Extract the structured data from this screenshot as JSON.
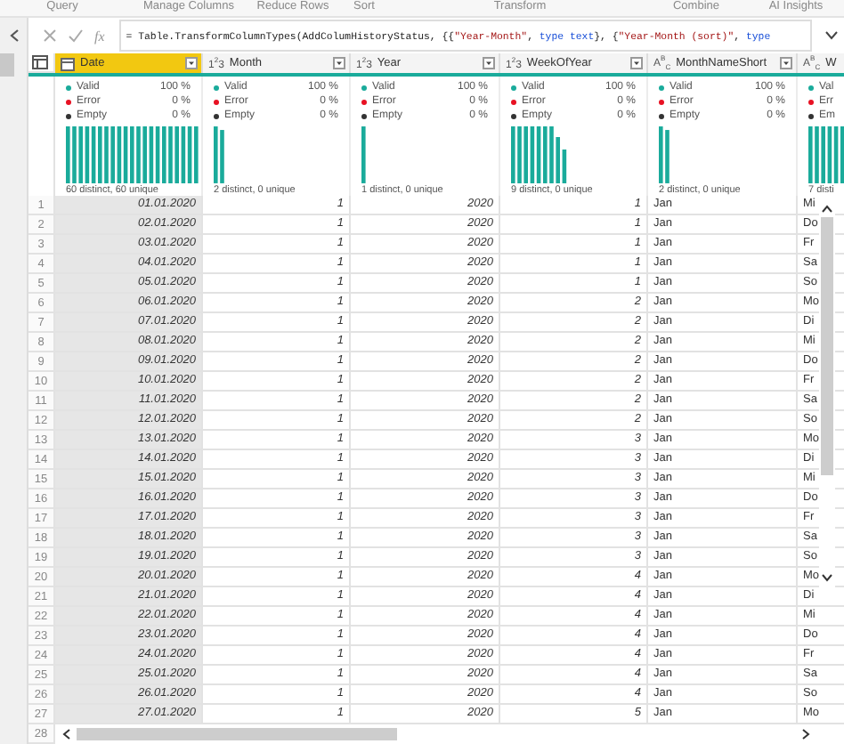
{
  "ribbon_groups": [
    "Query",
    "Manage Columns",
    "Reduce Rows",
    "Sort",
    "Transform",
    "Combine",
    "AI Insights"
  ],
  "formula_bar": {
    "fx": "fx",
    "formula": [
      {
        "kind": "plain",
        "text": "= Table.TransformColumnTypes(AddColumHistoryStatus, {{"
      },
      {
        "kind": "string",
        "text": "\"Year-Month\""
      },
      {
        "kind": "plain",
        "text": ", "
      },
      {
        "kind": "keyword",
        "text": "type text"
      },
      {
        "kind": "plain",
        "text": "}, {"
      },
      {
        "kind": "string",
        "text": "\"Year-Month (sort)\""
      },
      {
        "kind": "plain",
        "text": ", "
      },
      {
        "kind": "keyword",
        "text": "type"
      }
    ]
  },
  "columns": [
    {
      "name": "Date",
      "kind": "date",
      "selected": true,
      "quality": [
        {
          "kind": "valid",
          "label": "Valid",
          "value": "100 %"
        },
        {
          "kind": "error",
          "label": "Error",
          "value": "0 %"
        },
        {
          "kind": "empty",
          "label": "Empty",
          "value": "0 %"
        }
      ],
      "distinct": "60 distinct, 60 unique"
    },
    {
      "name": "Month",
      "kind": "number",
      "type_label": "1$^{2}$3",
      "selected": false,
      "quality": [
        {
          "kind": "valid",
          "label": "Valid",
          "value": "100 %"
        },
        {
          "kind": "error",
          "label": "Error",
          "value": "0 %"
        },
        {
          "kind": "empty",
          "label": "Empty",
          "value": "0 %"
        }
      ],
      "distinct": "2 distinct, 0 unique"
    },
    {
      "name": "Year",
      "kind": "number",
      "type_label": "1$^{2}$3",
      "selected": false,
      "quality": [
        {
          "kind": "valid",
          "label": "Valid",
          "value": "100 %"
        },
        {
          "kind": "error",
          "label": "Error",
          "value": "0 %"
        },
        {
          "kind": "empty",
          "label": "Empty",
          "value": "0 %"
        }
      ],
      "distinct": "1 distinct, 0 unique"
    },
    {
      "name": "WeekOfYear",
      "kind": "number",
      "type_label": "1$^{2}$3",
      "selected": false,
      "quality": [
        {
          "kind": "valid",
          "label": "Valid",
          "value": "100 %"
        },
        {
          "kind": "error",
          "label": "Error",
          "value": "0 %"
        },
        {
          "kind": "empty",
          "label": "Empty",
          "value": "0 %"
        }
      ],
      "distinct": "9 distinct, 0 unique"
    },
    {
      "name": "MonthNameShort",
      "kind": "text",
      "type_label": "A$^{B}$$_{C}$",
      "selected": false,
      "quality": [
        {
          "kind": "valid",
          "label": "Valid",
          "value": "100 %"
        },
        {
          "kind": "error",
          "label": "Error",
          "value": "0 %"
        },
        {
          "kind": "empty",
          "label": "Empty",
          "value": "0 %"
        }
      ],
      "distinct": "2 distinct, 0 unique"
    },
    {
      "name": "W",
      "kind": "text",
      "type_label": "A$^{B}$$_{C}$",
      "selected": false,
      "quality": [
        {
          "kind": "valid",
          "label": "Val"
        },
        {
          "kind": "error",
          "label": "Err"
        },
        {
          "kind": "empty",
          "label": "Em"
        }
      ],
      "distinct": "7 disti"
    }
  ],
  "rows": [
    {
      "number": "1",
      "cells": [
        "01.01.2020",
        "1",
        "2020",
        "1",
        "Jan",
        "Mi"
      ]
    },
    {
      "number": "2",
      "cells": [
        "02.01.2020",
        "1",
        "2020",
        "1",
        "Jan",
        "Do"
      ]
    },
    {
      "number": "3",
      "cells": [
        "03.01.2020",
        "1",
        "2020",
        "1",
        "Jan",
        "Fr"
      ]
    },
    {
      "number": "4",
      "cells": [
        "04.01.2020",
        "1",
        "2020",
        "1",
        "Jan",
        "Sa"
      ]
    },
    {
      "number": "5",
      "cells": [
        "05.01.2020",
        "1",
        "2020",
        "1",
        "Jan",
        "So"
      ]
    },
    {
      "number": "6",
      "cells": [
        "06.01.2020",
        "1",
        "2020",
        "2",
        "Jan",
        "Mo"
      ]
    },
    {
      "number": "7",
      "cells": [
        "07.01.2020",
        "1",
        "2020",
        "2",
        "Jan",
        "Di"
      ]
    },
    {
      "number": "8",
      "cells": [
        "08.01.2020",
        "1",
        "2020",
        "2",
        "Jan",
        "Mi"
      ]
    },
    {
      "number": "9",
      "cells": [
        "09.01.2020",
        "1",
        "2020",
        "2",
        "Jan",
        "Do"
      ]
    },
    {
      "number": "10",
      "cells": [
        "10.01.2020",
        "1",
        "2020",
        "2",
        "Jan",
        "Fr"
      ]
    },
    {
      "number": "11",
      "cells": [
        "11.01.2020",
        "1",
        "2020",
        "2",
        "Jan",
        "Sa"
      ]
    },
    {
      "number": "12",
      "cells": [
        "12.01.2020",
        "1",
        "2020",
        "2",
        "Jan",
        "So"
      ]
    },
    {
      "number": "13",
      "cells": [
        "13.01.2020",
        "1",
        "2020",
        "3",
        "Jan",
        "Mo"
      ]
    },
    {
      "number": "14",
      "cells": [
        "14.01.2020",
        "1",
        "2020",
        "3",
        "Jan",
        "Di"
      ]
    },
    {
      "number": "15",
      "cells": [
        "15.01.2020",
        "1",
        "2020",
        "3",
        "Jan",
        "Mi"
      ]
    },
    {
      "number": "16",
      "cells": [
        "16.01.2020",
        "1",
        "2020",
        "3",
        "Jan",
        "Do"
      ]
    },
    {
      "number": "17",
      "cells": [
        "17.01.2020",
        "1",
        "2020",
        "3",
        "Jan",
        "Fr"
      ]
    },
    {
      "number": "18",
      "cells": [
        "18.01.2020",
        "1",
        "2020",
        "3",
        "Jan",
        "Sa"
      ]
    },
    {
      "number": "19",
      "cells": [
        "19.01.2020",
        "1",
        "2020",
        "3",
        "Jan",
        "So"
      ]
    },
    {
      "number": "20",
      "cells": [
        "20.01.2020",
        "1",
        "2020",
        "4",
        "Jan",
        "Mo"
      ]
    },
    {
      "number": "21",
      "cells": [
        "21.01.2020",
        "1",
        "2020",
        "4",
        "Jan",
        "Di"
      ]
    },
    {
      "number": "22",
      "cells": [
        "22.01.2020",
        "1",
        "2020",
        "4",
        "Jan",
        "Mi"
      ]
    },
    {
      "number": "23",
      "cells": [
        "23.01.2020",
        "1",
        "2020",
        "4",
        "Jan",
        "Do"
      ]
    },
    {
      "number": "24",
      "cells": [
        "24.01.2020",
        "1",
        "2020",
        "4",
        "Jan",
        "Fr"
      ]
    },
    {
      "number": "25",
      "cells": [
        "25.01.2020",
        "1",
        "2020",
        "4",
        "Jan",
        "Sa"
      ]
    },
    {
      "number": "26",
      "cells": [
        "26.01.2020",
        "1",
        "2020",
        "4",
        "Jan",
        "So"
      ]
    },
    {
      "number": "27",
      "cells": [
        "27.01.2020",
        "1",
        "2020",
        "5",
        "Jan",
        "Mo"
      ]
    },
    {
      "number": "28"
    }
  ]
}
